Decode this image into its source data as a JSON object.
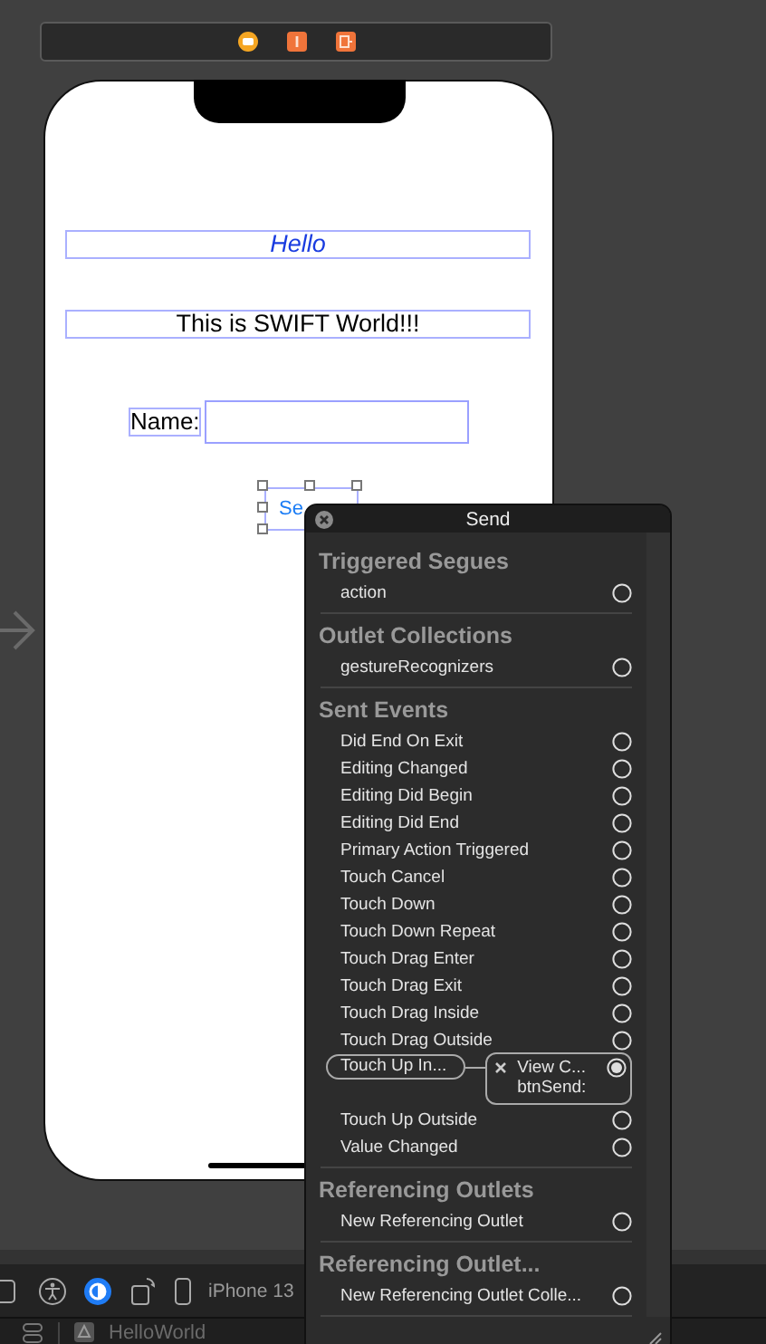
{
  "canvas": {
    "labels": [
      {
        "kind": "title",
        "text": "Hello"
      },
      {
        "kind": "plain",
        "text": "This is SWIFT World!!!"
      }
    ],
    "name_label": "Name:",
    "send_button": "Se"
  },
  "popover": {
    "title": "Send",
    "sections": [
      {
        "title": "Triggered Segues",
        "items": [
          {
            "label": "action",
            "connected": false
          }
        ]
      },
      {
        "title": "Outlet Collections",
        "items": [
          {
            "label": "gestureRecognizers",
            "connected": false
          }
        ]
      },
      {
        "title": "Sent Events",
        "items": [
          {
            "label": "Did End On Exit",
            "connected": false
          },
          {
            "label": "Editing Changed",
            "connected": false
          },
          {
            "label": "Editing Did Begin",
            "connected": false
          },
          {
            "label": "Editing Did End",
            "connected": false
          },
          {
            "label": "Primary Action Triggered",
            "connected": false
          },
          {
            "label": "Touch Cancel",
            "connected": false
          },
          {
            "label": "Touch Down",
            "connected": false
          },
          {
            "label": "Touch Down Repeat",
            "connected": false
          },
          {
            "label": "Touch Drag Enter",
            "connected": false
          },
          {
            "label": "Touch Drag Exit",
            "connected": false
          },
          {
            "label": "Touch Drag Inside",
            "connected": false
          },
          {
            "label": "Touch Drag Outside",
            "connected": false
          },
          {
            "label": "Touch Up In...",
            "connected": true,
            "target": "View C...",
            "action": "btnSend:"
          },
          {
            "label": "Touch Up Outside",
            "connected": false
          },
          {
            "label": "Value Changed",
            "connected": false
          }
        ]
      },
      {
        "title": "Referencing Outlets",
        "items": [
          {
            "label": "New Referencing Outlet",
            "connected": false
          }
        ]
      },
      {
        "title": "Referencing Outlet...",
        "items": [
          {
            "label": "New Referencing Outlet Colle...",
            "connected": false
          }
        ]
      }
    ]
  },
  "toolbar": {
    "device": "iPhone 13"
  },
  "bottom_bar": {
    "scheme": "HelloWorld"
  }
}
